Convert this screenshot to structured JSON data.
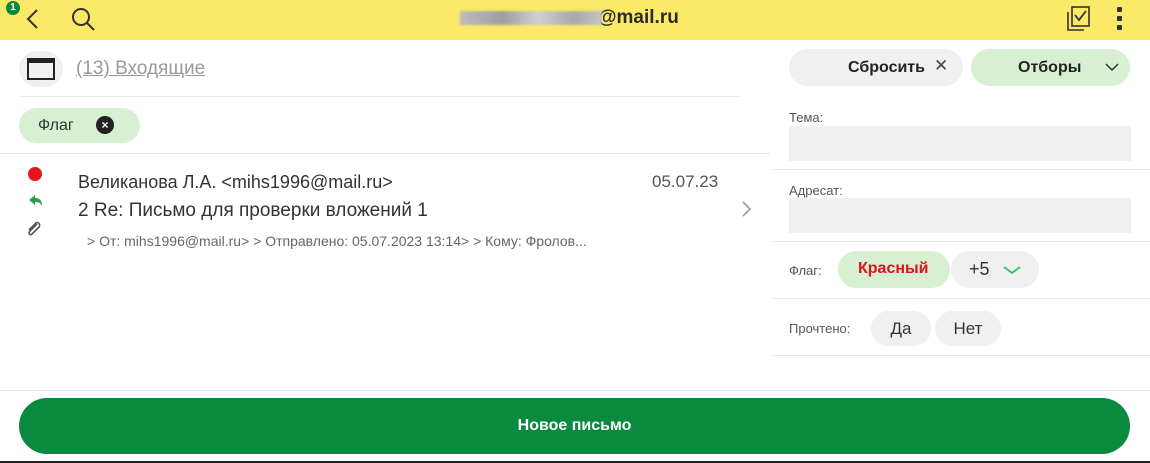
{
  "topbar": {
    "badge": "1",
    "account_suffix": "@mail.ru",
    "icons": [
      "chevron-left-icon",
      "search-icon",
      "select-all-icon",
      "more-vertical-icon"
    ],
    "bg_color": "#fbe968"
  },
  "folder": {
    "label": "(13) Входящие",
    "icon": "folder-icon"
  },
  "active_filter": {
    "label": "Флаг"
  },
  "message": {
    "sender": "Великанова Л.А. <mihs1996@mail.ru>",
    "date": "05.07.23",
    "subject": "2 Re: Письмо для проверки вложений 1",
    "preview": "> От: mihs1996@mail.ru> > Отправлено: 05.07.2023 13:14> > Кому: Фролов...",
    "flag_color": "#e8141e",
    "icons": [
      "flag-dot-icon",
      "reply-icon",
      "attachment-icon",
      "chevron-right-icon"
    ]
  },
  "filters": {
    "reset_label": "Сбросить",
    "filters_label": "Отборы",
    "subject_label": "Тема:",
    "subject_value": "",
    "recipient_label": "Адресат:",
    "recipient_value": "",
    "flag_label": "Флаг:",
    "flag_selected": "Красный",
    "flag_more": "+5",
    "read_label": "Прочтено:",
    "read_yes": "Да",
    "read_no": "Нет"
  },
  "new_message_label": "Новое письмо",
  "colors": {
    "accent_green": "#0a8a3e",
    "chip_green": "#d8f0d2",
    "red": "#e0101a"
  }
}
